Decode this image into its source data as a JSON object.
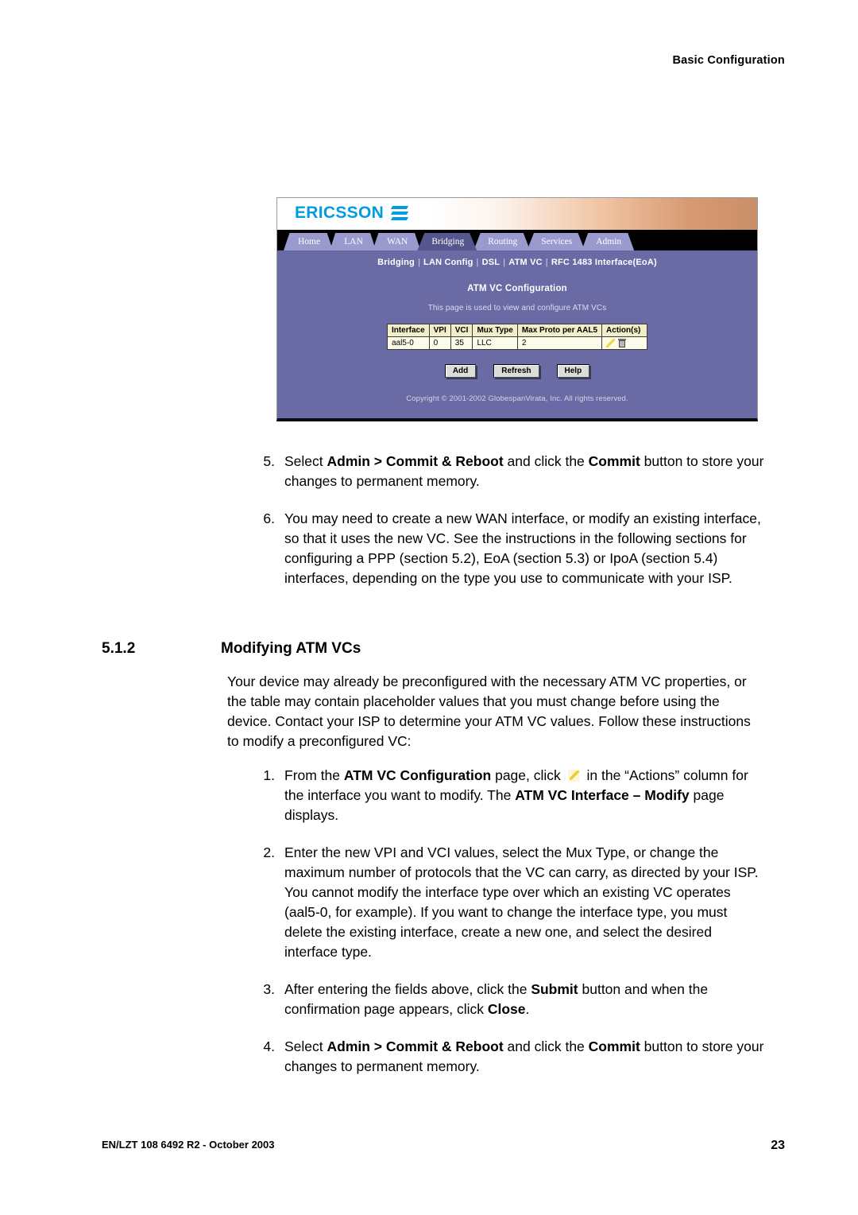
{
  "page": {
    "header_right": "Basic Configuration",
    "footer_left": "EN/LZT 108 6492 R2 - October 2003",
    "footer_page_number": "23"
  },
  "screenshot": {
    "brand": "ERICSSON",
    "tabs": [
      {
        "label": "Home",
        "active": false
      },
      {
        "label": "LAN",
        "active": false
      },
      {
        "label": "WAN",
        "active": false
      },
      {
        "label": "Bridging",
        "active": true
      },
      {
        "label": "Routing",
        "active": false
      },
      {
        "label": "Services",
        "active": false
      },
      {
        "label": "Admin",
        "active": false
      }
    ],
    "subnav": [
      "Bridging",
      "LAN Config",
      "DSL",
      "ATM VC",
      "RFC 1483 Interface(EoA)"
    ],
    "subnav_separator": "|",
    "title": "ATM VC Configuration",
    "description": "This page is used to view and configure ATM VCs",
    "table": {
      "headers": [
        "Interface",
        "VPI",
        "VCI",
        "Mux Type",
        "Max Proto per AAL5",
        "Action(s)"
      ],
      "rows": [
        {
          "interface": "aal5-0",
          "vpi": "0",
          "vci": "35",
          "mux_type": "LLC",
          "max_proto": "2",
          "actions": [
            "pencil-icon",
            "trash-icon"
          ]
        }
      ]
    },
    "buttons": [
      {
        "label": "Add"
      },
      {
        "label": "Refresh"
      },
      {
        "label": "Help"
      }
    ],
    "copyright": "Copyright © 2001-2002 GlobespanVirata, Inc. All rights reserved.",
    "colors": {
      "panel_purple": "#6a6aa4",
      "tab_inactive": "#9a9ace",
      "tab_active": "#56568f",
      "brand_blue": "#009de0",
      "table_bg": "#fdfbe9",
      "table_header_bg": "#f2eec8"
    }
  },
  "content": {
    "steps_top": [
      {
        "number": "5.",
        "parts": [
          {
            "t": "Select ",
            "b": false
          },
          {
            "t": "Admin > Commit & Reboot",
            "b": true
          },
          {
            "t": " and click the ",
            "b": false
          },
          {
            "t": "Commit",
            "b": true
          },
          {
            "t": " button to store your changes to permanent memory.",
            "b": false
          }
        ]
      },
      {
        "number": "6.",
        "parts": [
          {
            "t": "You may need to create a new WAN interface, or modify an existing interface, so that it uses the new VC. See the instructions in the following sections for configuring a PPP (section 5.2), EoA (section 5.3) or IpoA (section 5.4) interfaces, depending on the type you use to communicate with your ISP.",
            "b": false
          }
        ]
      }
    ],
    "section": {
      "number": "5.1.2",
      "title": "Modifying ATM VCs",
      "intro": "Your device may already be preconfigured with the necessary ATM VC properties, or the table may contain placeholder values that you must change before using the device. Contact your ISP to determine your ATM VC values. Follow these instructions to modify a preconfigured VC:"
    },
    "steps_bottom": [
      {
        "number": "1.",
        "parts": [
          {
            "t": "From the ",
            "b": false
          },
          {
            "t": "ATM VC Configuration",
            "b": true
          },
          {
            "t": " page, click ",
            "b": false
          },
          {
            "t": "",
            "b": false,
            "icon": "pencil-icon"
          },
          {
            "t": " in the “Actions” column for the interface you want to modify. The ",
            "b": false
          },
          {
            "t": "ATM VC Interface – Modify",
            "b": true
          },
          {
            "t": " page displays.",
            "b": false
          }
        ]
      },
      {
        "number": "2.",
        "parts": [
          {
            "t": "Enter the new VPI and VCI values, select the Mux Type, or change the maximum number of protocols that the VC can carry, as directed by your ISP.",
            "b": false
          },
          {
            "t": "BREAK",
            "b": false,
            "br": true
          },
          {
            "t": "You cannot modify the interface type over which an existing VC operates (aal5-0, for example). If you want to change the interface type, you must delete the existing interface, create a new one, and select the desired interface type.",
            "b": false
          }
        ]
      },
      {
        "number": "3.",
        "parts": [
          {
            "t": "After entering the fields above, click the ",
            "b": false
          },
          {
            "t": "Submit",
            "b": true
          },
          {
            "t": " button and when the confirmation page appears, click ",
            "b": false
          },
          {
            "t": "Close",
            "b": true
          },
          {
            "t": ".",
            "b": false
          }
        ]
      },
      {
        "number": "4.",
        "parts": [
          {
            "t": "Select ",
            "b": false
          },
          {
            "t": "Admin > Commit & Reboot",
            "b": true
          },
          {
            "t": " and click the ",
            "b": false
          },
          {
            "t": "Commit",
            "b": true
          },
          {
            "t": " button to store your changes to permanent memory.",
            "b": false
          }
        ]
      }
    ]
  }
}
